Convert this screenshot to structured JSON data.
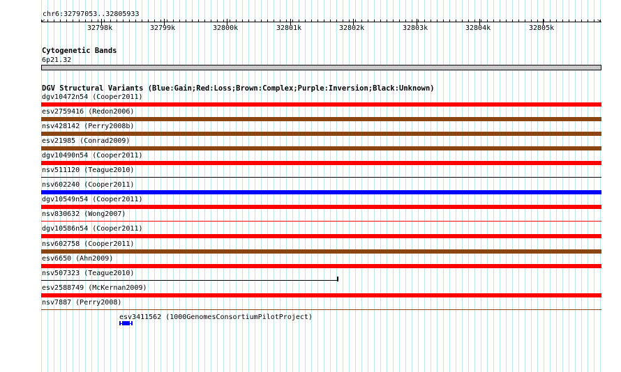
{
  "ruler": {
    "position": "chr6:32797053..32805933",
    "ticks": [
      "32798k",
      "32799k",
      "32800k",
      "32801k",
      "32802k",
      "32803k",
      "32804k",
      "32805k"
    ]
  },
  "cytoband": {
    "title": "Cytogenetic Bands",
    "band": "6p21.32"
  },
  "dgv": {
    "title": "DGV Structural Variants (Blue:Gain;Red:Loss;Brown:Complex;Purple:Inversion;Black:Unknown)",
    "colors": {
      "loss": "#ff0000",
      "complex": "#8b4513",
      "gain": "#0000ff",
      "unknown": "#000000"
    },
    "features": [
      {
        "label": "dgv10472n54 (Cooper2011)",
        "type": "loss"
      },
      {
        "label": "esv2759416 (Redon2006)",
        "type": "complex"
      },
      {
        "label": "nsv428142 (Perry2008b)",
        "type": "complex"
      },
      {
        "label": "esv21985 (Conrad2009)",
        "type": "complex"
      },
      {
        "label": "dgv10490n54 (Cooper2011)",
        "type": "loss"
      },
      {
        "label": "nsv511120 (Teague2010)",
        "type": "unknown-thin"
      },
      {
        "label": "nsv602240 (Cooper2011)",
        "type": "gain"
      },
      {
        "label": "dgv10549n54 (Cooper2011)",
        "type": "loss"
      },
      {
        "label": "nsv830632 (Wong2007)",
        "type": "loss-thin"
      },
      {
        "label": "dgv10586n54 (Cooper2011)",
        "type": "loss"
      },
      {
        "label": "nsv602758 (Cooper2011)",
        "type": "complex"
      },
      {
        "label": "esv6650 (Ahn2009)",
        "type": "loss"
      },
      {
        "label": "nsv507323 (Teague2010)",
        "type": "unknown-partial"
      },
      {
        "label": "esv2588749 (McKernan2009)",
        "type": "loss"
      },
      {
        "label": "nsv7887 (Perry2008)",
        "type": "complex-thin"
      }
    ],
    "extra": {
      "label": "esv3411562 (1000GenomesConsortiumPilotProject)",
      "type": "gain-small"
    }
  }
}
